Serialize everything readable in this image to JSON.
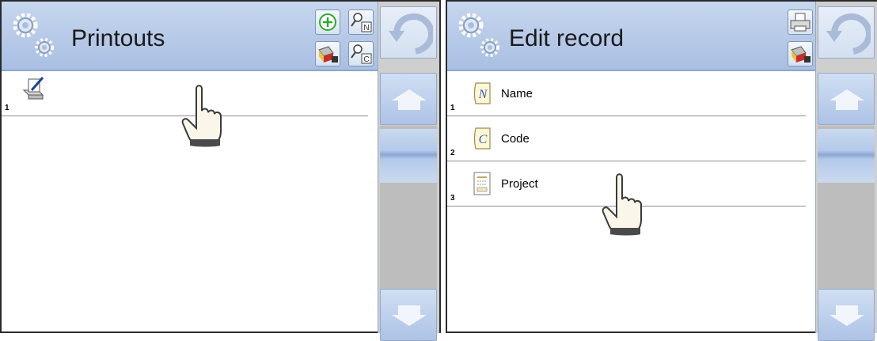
{
  "left_screen": {
    "title": "Printouts",
    "toolbar": [
      "add-icon",
      "search-by-name-icon",
      "export-icon",
      "search-by-code-icon"
    ],
    "nav": [
      "undo-icon",
      "up-arrow-icon",
      "down-arrow-icon"
    ],
    "rows": [
      {
        "number": "1",
        "icon": "printout-edit-icon",
        "label": ""
      }
    ]
  },
  "right_screen": {
    "title": "Edit record",
    "toolbar": [
      "printer-icon",
      "export-icon"
    ],
    "nav": [
      "undo-icon",
      "up-arrow-icon",
      "down-arrow-icon"
    ],
    "rows": [
      {
        "number": "1",
        "icon": "name-field-icon",
        "label": "Name"
      },
      {
        "number": "2",
        "icon": "code-field-icon",
        "label": "Code"
      },
      {
        "number": "3",
        "icon": "project-template-icon",
        "label": "Project"
      }
    ]
  },
  "colors": {
    "header": "#b6c9e8",
    "sidebar_track": "#bdbdbd",
    "border": "#2a2a2a",
    "add_icon_green": "#2eaa2e"
  }
}
